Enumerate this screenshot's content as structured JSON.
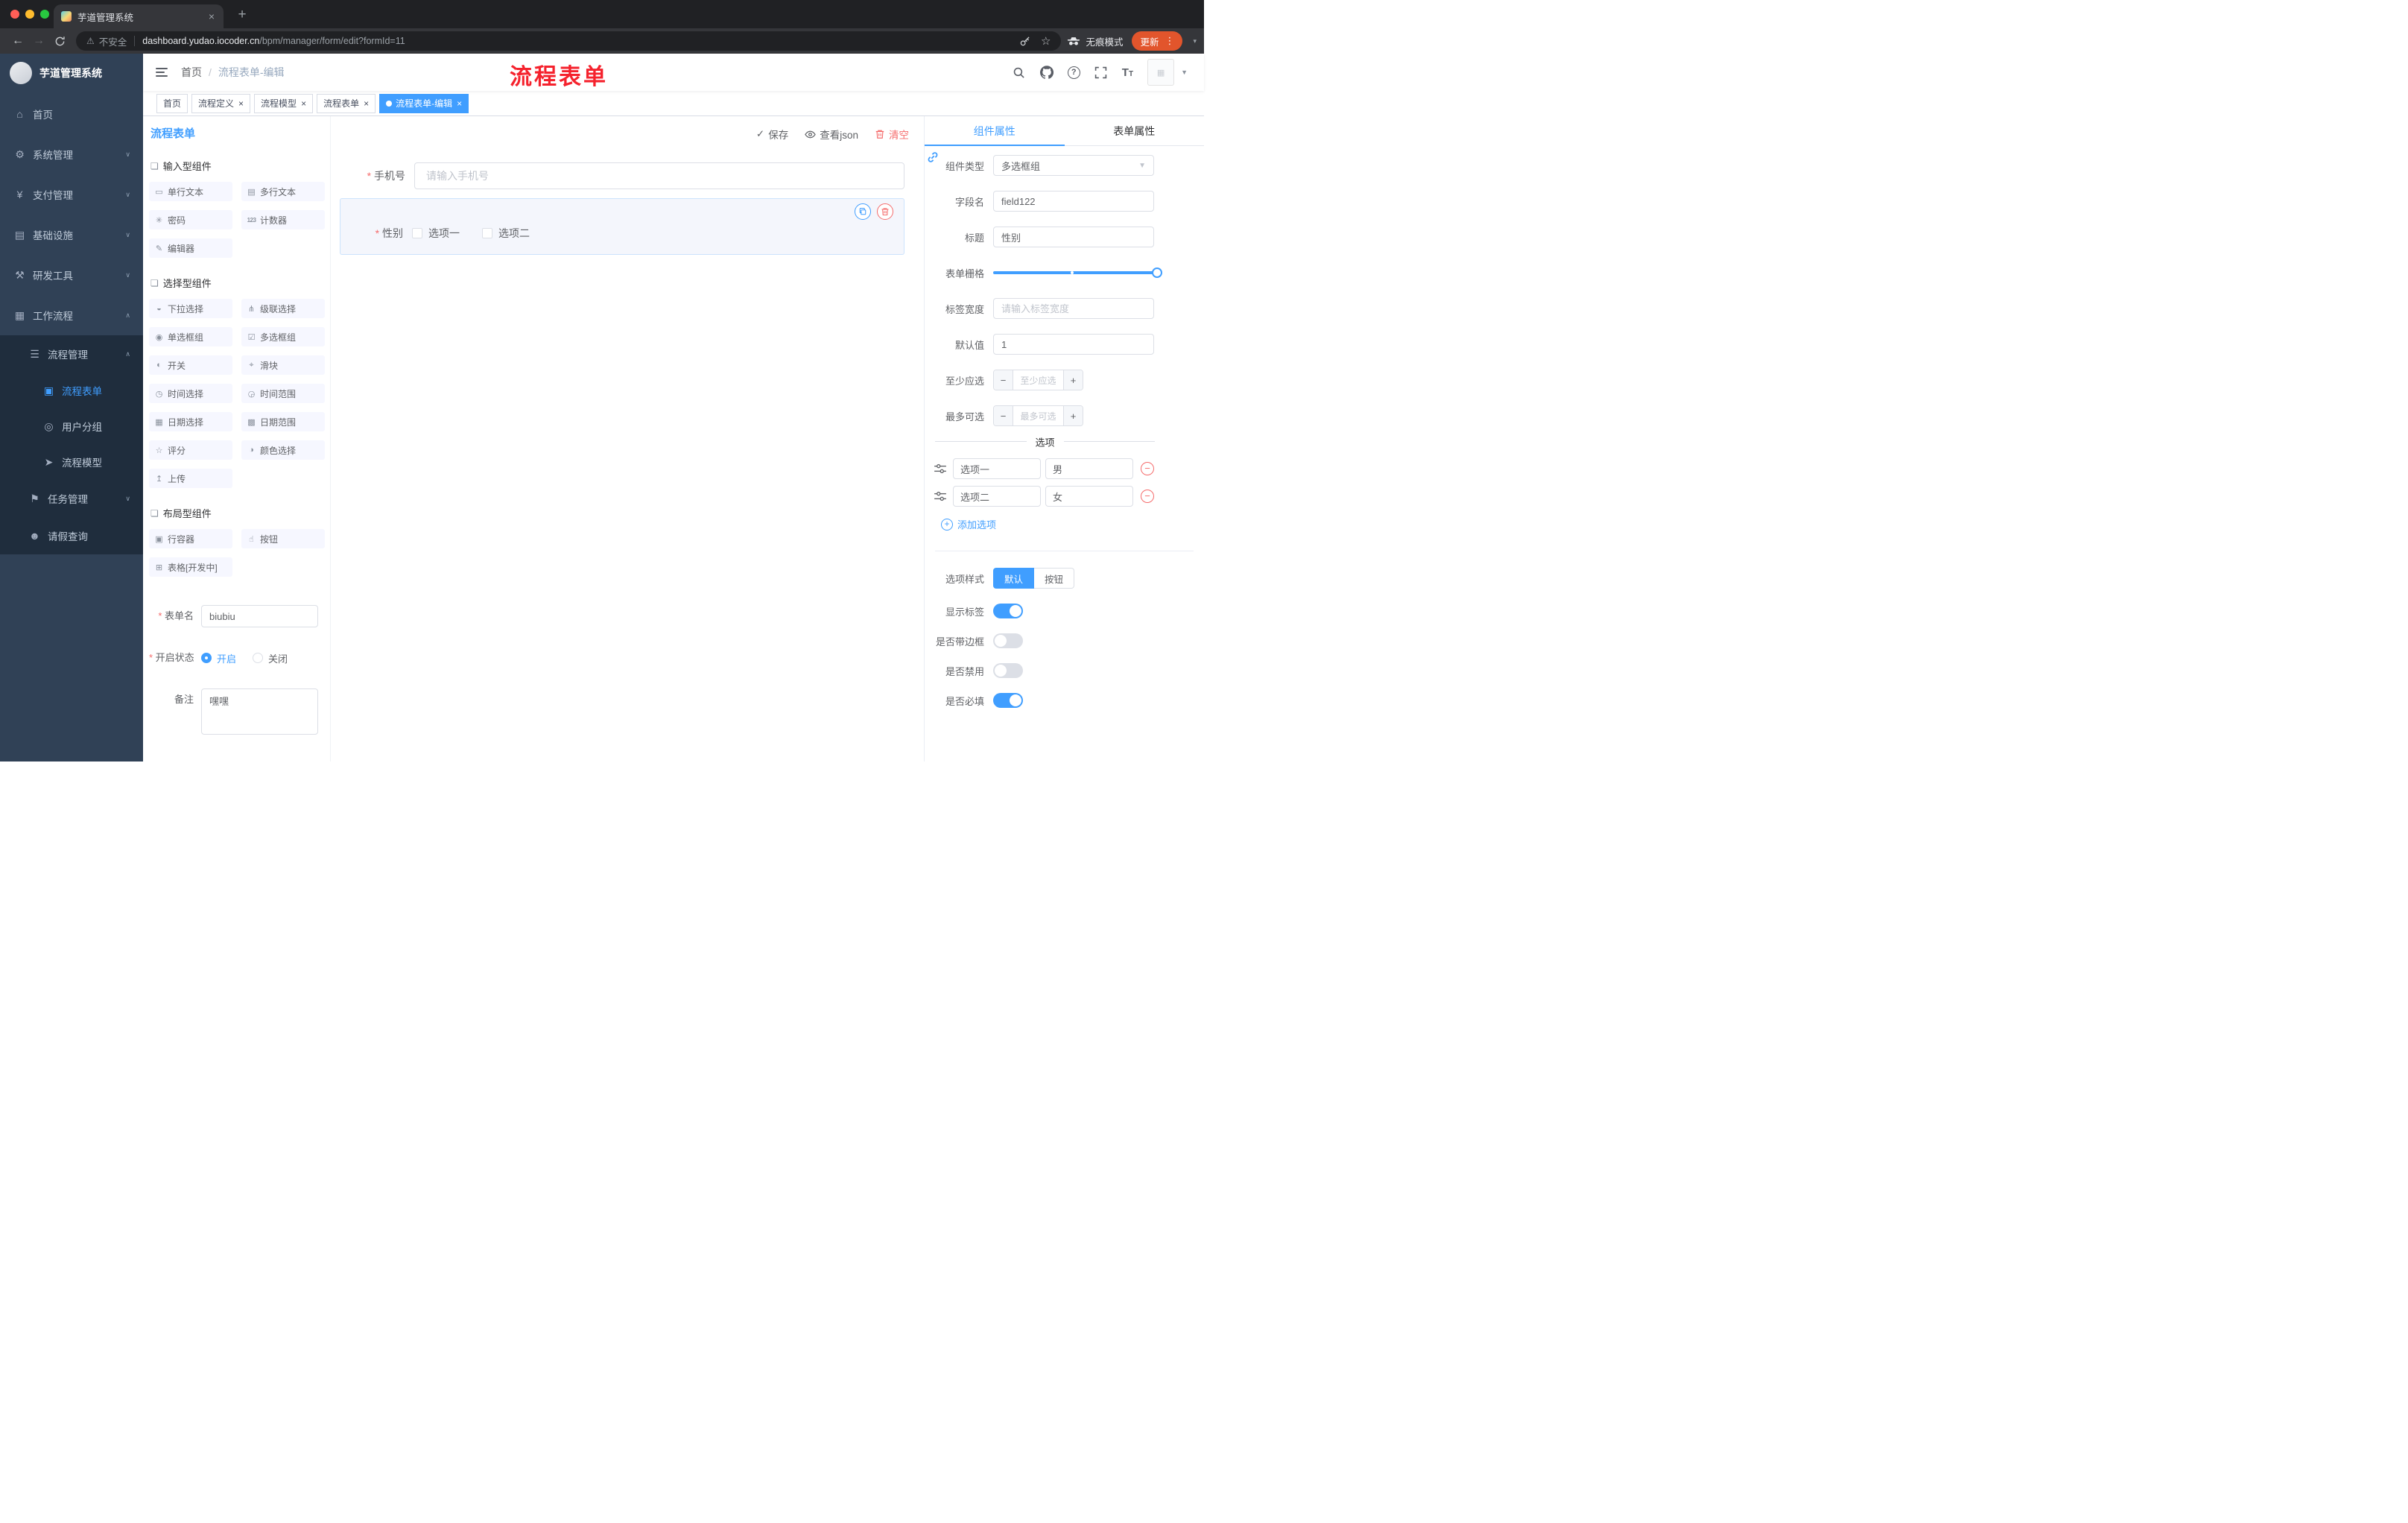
{
  "colors": {
    "primary": "#409EFF",
    "danger": "#F56C6C",
    "annotation_red": "#F5222D",
    "sidebar_bg": "#304156",
    "update_button": "#E2552C"
  },
  "browser": {
    "tab_title": "芋道管理系统",
    "security_label": "不安全",
    "url_domain": "dashboard.yudao.iocoder.cn",
    "url_path": "/bpm/manager/form/edit?formId=11",
    "incognito_label": "无痕模式",
    "update_label": "更新"
  },
  "sidebar": {
    "logo_title": "芋道管理系统",
    "items": [
      {
        "label": "首页"
      },
      {
        "label": "系统管理"
      },
      {
        "label": "支付管理"
      },
      {
        "label": "基础设施"
      },
      {
        "label": "研发工具"
      },
      {
        "label": "工作流程"
      },
      {
        "label": "流程管理"
      },
      {
        "label": "流程表单"
      },
      {
        "label": "用户分组"
      },
      {
        "label": "流程模型"
      },
      {
        "label": "任务管理"
      },
      {
        "label": "请假查询"
      }
    ]
  },
  "header": {
    "breadcrumb_home": "首页",
    "breadcrumb_current": "流程表单-编辑",
    "annotation": "流程表单"
  },
  "tags": [
    {
      "label": "首页"
    },
    {
      "label": "流程定义"
    },
    {
      "label": "流程模型"
    },
    {
      "label": "流程表单"
    },
    {
      "label": "流程表单-编辑"
    }
  ],
  "left_panel": {
    "title": "流程表单",
    "sections": [
      {
        "title": "输入型组件",
        "items": [
          {
            "label": "单行文本"
          },
          {
            "label": "多行文本"
          },
          {
            "label": "密码"
          },
          {
            "label": "计数器"
          },
          {
            "label": "编辑器"
          }
        ]
      },
      {
        "title": "选择型组件",
        "items": [
          {
            "label": "下拉选择"
          },
          {
            "label": "级联选择"
          },
          {
            "label": "单选框组"
          },
          {
            "label": "多选框组"
          },
          {
            "label": "开关"
          },
          {
            "label": "滑块"
          },
          {
            "label": "时间选择"
          },
          {
            "label": "时间范围"
          },
          {
            "label": "日期选择"
          },
          {
            "label": "日期范围"
          },
          {
            "label": "评分"
          },
          {
            "label": "颜色选择"
          },
          {
            "label": "上传"
          }
        ]
      },
      {
        "title": "布局型组件",
        "items": [
          {
            "label": "行容器"
          },
          {
            "label": "按钮"
          },
          {
            "label": "表格[开发中]"
          }
        ]
      }
    ],
    "form": {
      "name_label": "表单名",
      "name_value": "biubiu",
      "status_label": "开启状态",
      "status_on": "开启",
      "status_off": "关闭",
      "remark_label": "备注",
      "remark_value": "嘿嘿"
    }
  },
  "canvas": {
    "save_label": "保存",
    "view_json_label": "查看json",
    "clear_label": "清空",
    "phone_label": "手机号",
    "phone_placeholder": "请输入手机号",
    "gender_label": "性别",
    "gender_option1": "选项一",
    "gender_option2": "选项二"
  },
  "right_panel": {
    "tab_component": "组件属性",
    "tab_form": "表单属性",
    "component_type_label": "组件类型",
    "component_type_value": "多选框组",
    "field_name_label": "字段名",
    "field_name_value": "field122",
    "title_label": "标题",
    "title_value": "性别",
    "grid_label": "表单栅格",
    "label_width_label": "标签宽度",
    "label_width_placeholder": "请输入标签宽度",
    "default_label": "默认值",
    "default_value": "1",
    "min_label": "至少应选",
    "min_placeholder": "至少应选",
    "max_label": "最多可选",
    "max_placeholder": "最多可选",
    "options_title": "选项",
    "options": [
      {
        "label": "选项一",
        "value": "男"
      },
      {
        "label": "选项二",
        "value": "女"
      }
    ],
    "add_option_label": "添加选项",
    "style_label": "选项样式",
    "style_default": "默认",
    "style_button": "按钮",
    "toggles": [
      {
        "label": "显示标签",
        "state": "on"
      },
      {
        "label": "是否带边框",
        "state": "off"
      },
      {
        "label": "是否禁用",
        "state": "off"
      },
      {
        "label": "是否必填",
        "state": "on"
      }
    ]
  }
}
